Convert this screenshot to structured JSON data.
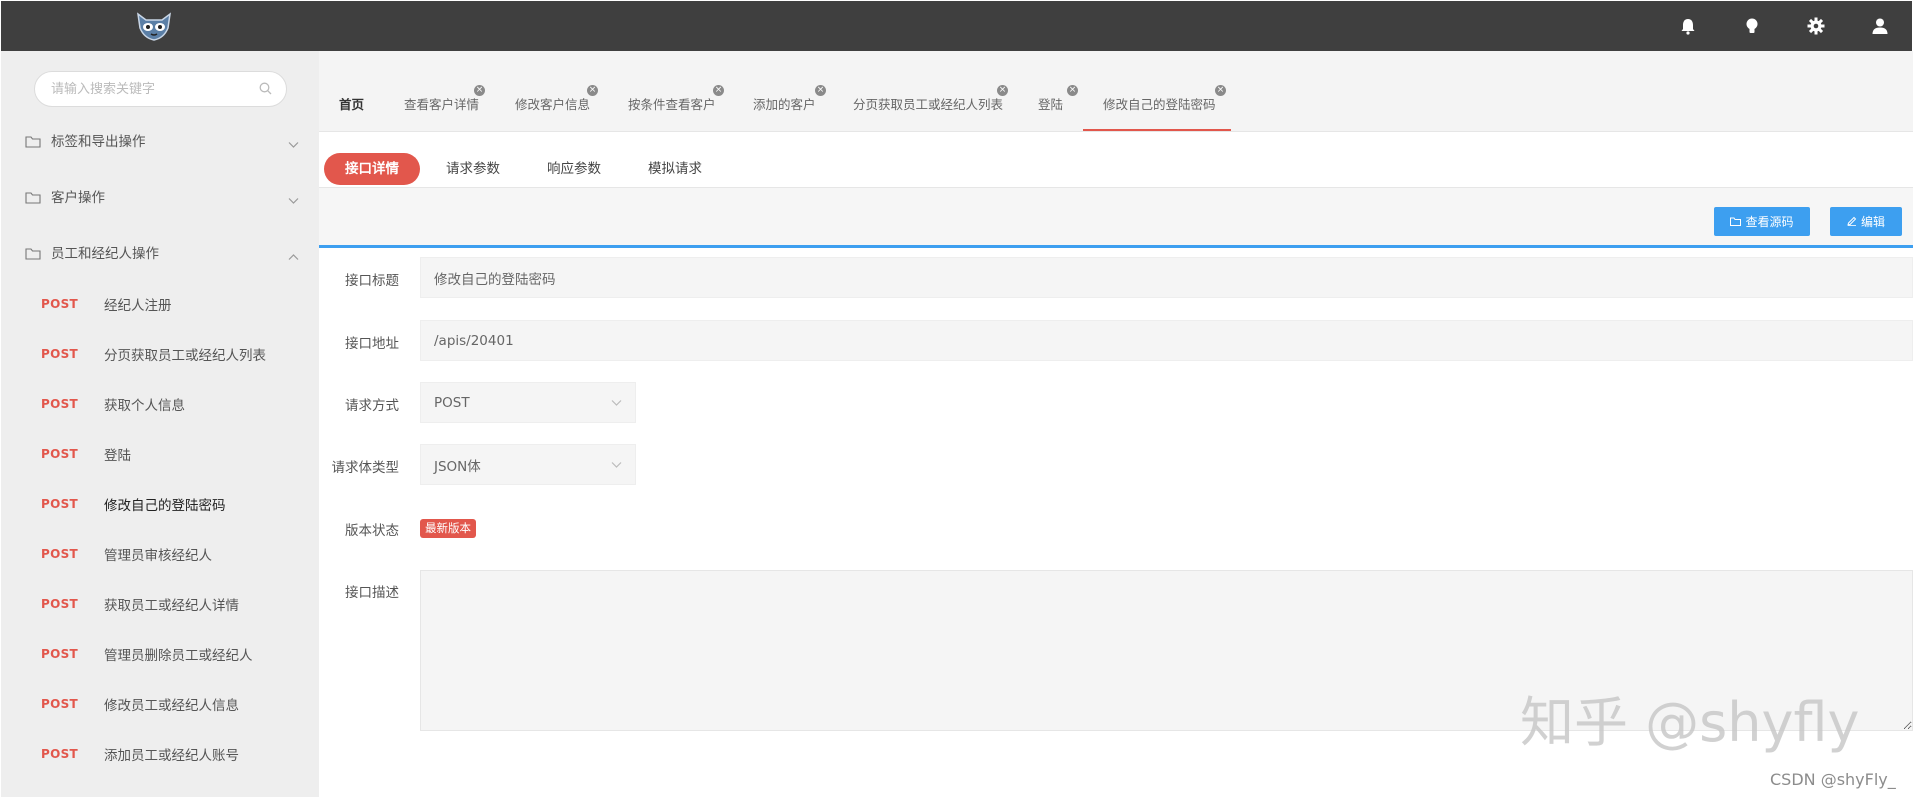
{
  "search": {
    "placeholder": "请输入搜索关键字"
  },
  "sidebar": {
    "groups": [
      {
        "label": "标签和导出操作"
      },
      {
        "label": "客户操作"
      },
      {
        "label": "员工和经纪人操作"
      }
    ],
    "items": [
      {
        "method": "POST",
        "label": "经纪人注册"
      },
      {
        "method": "POST",
        "label": "分页获取员工或经纪人列表"
      },
      {
        "method": "POST",
        "label": "获取个人信息"
      },
      {
        "method": "POST",
        "label": "登陆"
      },
      {
        "method": "POST",
        "label": "修改自己的登陆密码"
      },
      {
        "method": "POST",
        "label": "管理员审核经纪人"
      },
      {
        "method": "POST",
        "label": "获取员工或经纪人详情"
      },
      {
        "method": "POST",
        "label": "管理员删除员工或经纪人"
      },
      {
        "method": "POST",
        "label": "修改员工或经纪人信息"
      },
      {
        "method": "POST",
        "label": "添加员工或经纪人账号"
      }
    ]
  },
  "tabs": [
    {
      "label": "首页"
    },
    {
      "label": "查看客户详情"
    },
    {
      "label": "修改客户信息"
    },
    {
      "label": "按条件查看客户"
    },
    {
      "label": "添加的客户"
    },
    {
      "label": "分页获取员工或经纪人列表"
    },
    {
      "label": "登陆"
    },
    {
      "label": "修改自己的登陆密码"
    }
  ],
  "subtabs": [
    "接口详情",
    "请求参数",
    "响应参数",
    "模拟请求"
  ],
  "toolbar": {
    "view_source": "查看源码",
    "edit": "编辑"
  },
  "form": {
    "title_label": "接口标题",
    "title_value": "修改自己的登陆密码",
    "url_label": "接口地址",
    "url_value": "/apis/20401",
    "method_label": "请求方式",
    "method_value": "POST",
    "body_label": "请求体类型",
    "body_value": "JSON体",
    "version_label": "版本状态",
    "version_badge": "最新版本",
    "desc_label": "接口描述"
  },
  "watermark": "知乎 @shyfly",
  "credit": "CSDN @shyFly_",
  "colors": {
    "accent": "#e2574c",
    "primary": "#3d9ff0",
    "topbar": "#3f3f3f"
  }
}
